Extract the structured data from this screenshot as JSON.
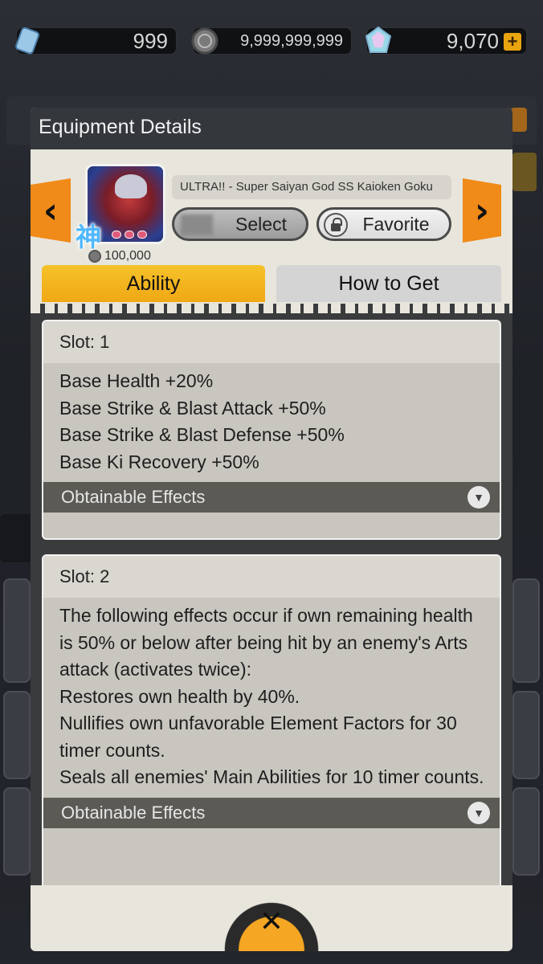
{
  "currency": {
    "tickets": "999",
    "zeni": "9,999,999,999",
    "chrono_crystals": "9,070",
    "plus_label": "+"
  },
  "modal": {
    "title": "Equipment Details",
    "character_name": "ULTRA!! - Super Saiyan God SS Kaioken Goku",
    "kanji_badge": "神",
    "cost": "100,000",
    "select_label": "Select",
    "favorite_label": "Favorite",
    "prev_arrow": "‹",
    "next_arrow": "›",
    "tabs": [
      {
        "label": "Ability",
        "active": true
      },
      {
        "label": "How to Get",
        "active": false
      }
    ],
    "slots": [
      {
        "title": "Slot: 1",
        "lines": [
          "Base Health +20%",
          "Base Strike & Blast Attack +50%",
          "Base Strike & Blast Defense +50%",
          "Base Ki Recovery +50%"
        ],
        "obtainable_label": "Obtainable Effects"
      },
      {
        "title": "Slot: 2",
        "lines": [
          "The following effects occur if own remaining health is 50% or below after being hit by an enemy's Arts attack (activates twice):",
          "Restores own health by 40%.",
          "Nullifies own unfavorable Element Factors for 30 timer counts.",
          "Seals all enemies' Main Abilities for 10 timer counts."
        ],
        "obtainable_label": "Obtainable Effects"
      }
    ],
    "close_label": "✕"
  },
  "colors": {
    "accent_orange": "#f08a18",
    "tab_active": "#f0a814",
    "header_dark": "#34373c"
  }
}
